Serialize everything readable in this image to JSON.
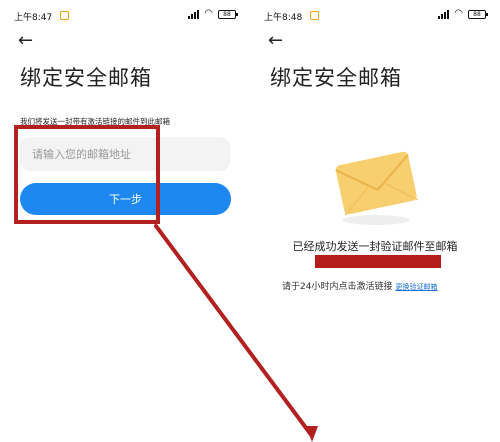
{
  "left_screen": {
    "status": {
      "time": "上午8:47",
      "signal": "ıll",
      "battery": "88"
    },
    "back_icon": "←",
    "title": "绑定安全邮箱",
    "hint": "我们将发送一封带有激活链接的邮件到此邮箱",
    "email_placeholder": "请输入您的邮箱地址",
    "next_button": "下一步"
  },
  "right_screen": {
    "status": {
      "time": "上午8:48",
      "signal": "ıll",
      "battery": "88"
    },
    "back_icon": "←",
    "title": "绑定安全邮箱",
    "success_message": "已经成功发送一封验证邮件至邮箱",
    "tip": "请于24小时内点击激活链接",
    "change_link": "更换验证邮箱"
  },
  "colors": {
    "accent": "#1e88f0",
    "annotation": "#b22020",
    "envelope": "#f7cf6e",
    "link": "#1a6fd8"
  }
}
